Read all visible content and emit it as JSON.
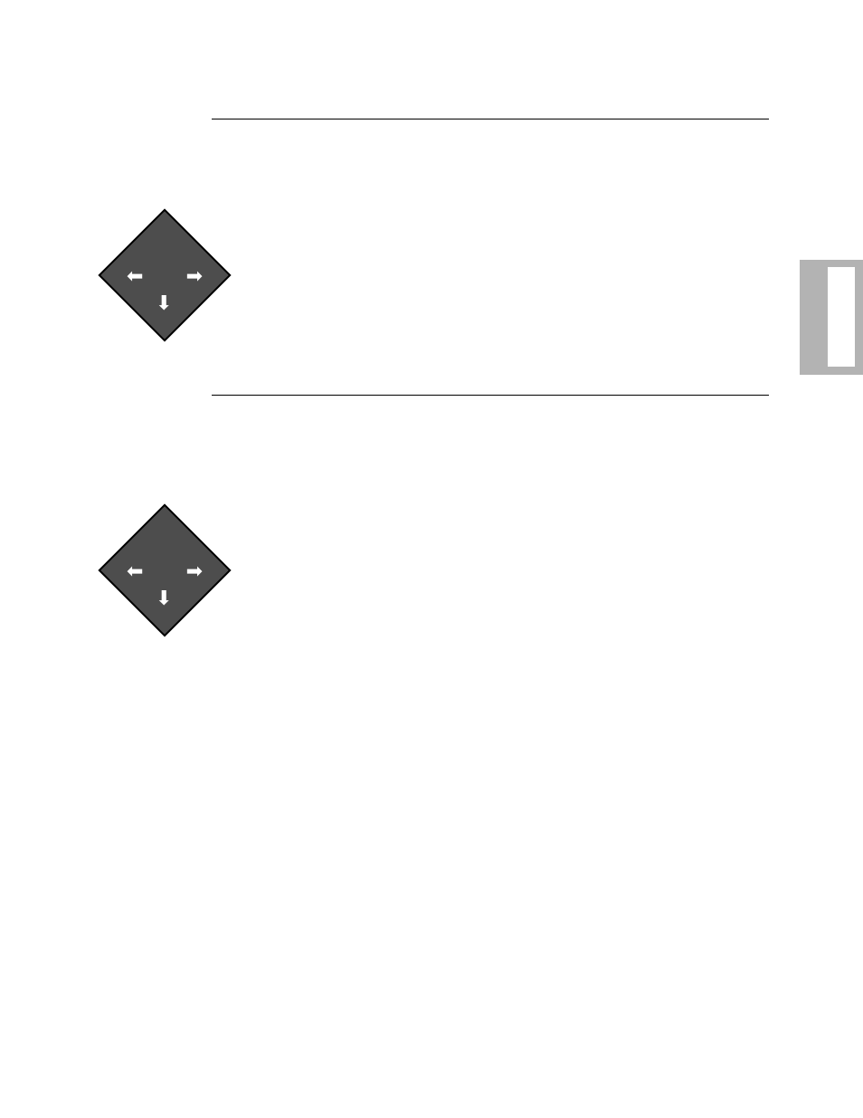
{
  "rules": {
    "top": true,
    "mid": true
  },
  "sideTab": true,
  "diamonds": [
    {
      "id": "d1",
      "arrows": [
        "left",
        "right",
        "down"
      ]
    },
    {
      "id": "d2",
      "arrows": [
        "left",
        "right",
        "down"
      ]
    }
  ]
}
